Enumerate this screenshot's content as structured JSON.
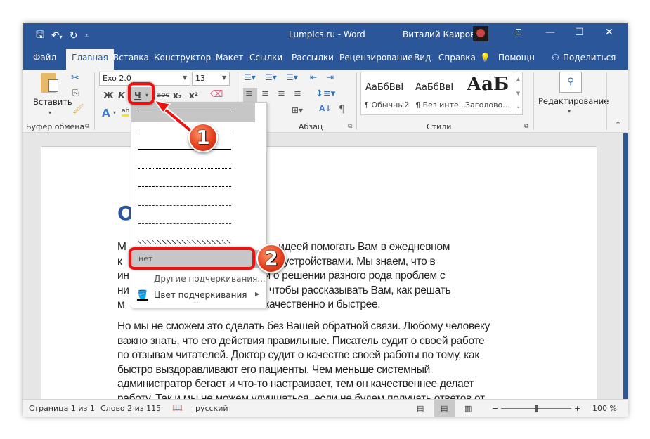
{
  "titlebar": {
    "title": "Lumpics.ru  -  Word",
    "user": "Виталий Каиров",
    "qat_icons": [
      "autosave-icon",
      "undo-icon",
      "redo-icon",
      "customize-qat-icon"
    ],
    "window_buttons": [
      "ribbon-display-options",
      "minimize",
      "maximize",
      "close"
    ]
  },
  "tabs": [
    {
      "label": "Файл",
      "active": false
    },
    {
      "label": "Главная",
      "active": true
    },
    {
      "label": "Вставка",
      "active": false
    },
    {
      "label": "Конструктор",
      "active": false
    },
    {
      "label": "Макет",
      "active": false
    },
    {
      "label": "Ссылки",
      "active": false
    },
    {
      "label": "Рассылки",
      "active": false
    },
    {
      "label": "Рецензирование",
      "active": false
    },
    {
      "label": "Вид",
      "active": false
    },
    {
      "label": "Справка",
      "active": false
    },
    {
      "label": "Помощн",
      "active": false
    },
    {
      "label": "Поделиться",
      "active": false
    }
  ],
  "ribbon": {
    "clipboard": {
      "paste_label": "Вставить",
      "group_label": "Буфер обмена"
    },
    "font": {
      "font_name": "Exo 2.0",
      "font_size": "13",
      "bold": "Ж",
      "italic": "К",
      "underline": "Ч",
      "strike": "abc",
      "subscript": "x₂",
      "superscript": "x²"
    },
    "paragraph": {
      "group_label": "Абзац"
    },
    "styles": {
      "group_label": "Стили",
      "items": [
        {
          "preview": "АаБбВвІ",
          "name": "¶ Обычный"
        },
        {
          "preview": "АаБбВвІ",
          "name": "¶ Без инте..."
        },
        {
          "preview": "АаБ",
          "name": "Заголово..."
        }
      ]
    },
    "editing": {
      "label": "Редактирование"
    }
  },
  "underline_menu": {
    "styles": [
      "single",
      "double",
      "thick",
      "dotted",
      "dashed",
      "dash-dot",
      "dash-dot-dot",
      "wave"
    ],
    "none_label": "нет",
    "more_label": "Другие подчеркивания...",
    "color_label": "Цвет подчеркивания"
  },
  "annotations": {
    "badge1": "1",
    "badge2": "2"
  },
  "document": {
    "heading": "О",
    "paragraph1": [
      "М                                 одержимых идеей помогать Вам в ежедневном",
      "к                                  мобильными устройствами. Мы знаем, что в",
      "ин                                формации о решении разного рода проблем с",
      "ни                               ивает нас, чтобы рассказывать Вам, как решать",
      "м                                 ии более качественно и быстрее."
    ],
    "paragraph2": [
      "Но мы не сможем это сделать без Вашей обратной связи. Любому человеку",
      "важно знать, что его действия правильные. Писатель судит о своей работе",
      "по отзывам читателей. Доктор судит о качестве своей работы по тому, как",
      "быстро выздоравливают его пациенты. Чем меньше системный",
      "администратор бегает и что-то настраивает, тем он качественнее делает",
      "работу. Так и мы не можем улучшаться, если не будем получать ответов от"
    ]
  },
  "statusbar": {
    "page": "Страница 1 из 1",
    "words": "Слово 2 из 115",
    "language": "русский",
    "zoom_minus": "−",
    "zoom_plus": "+",
    "zoom_level": "100 %",
    "zoom_percent": 100
  }
}
